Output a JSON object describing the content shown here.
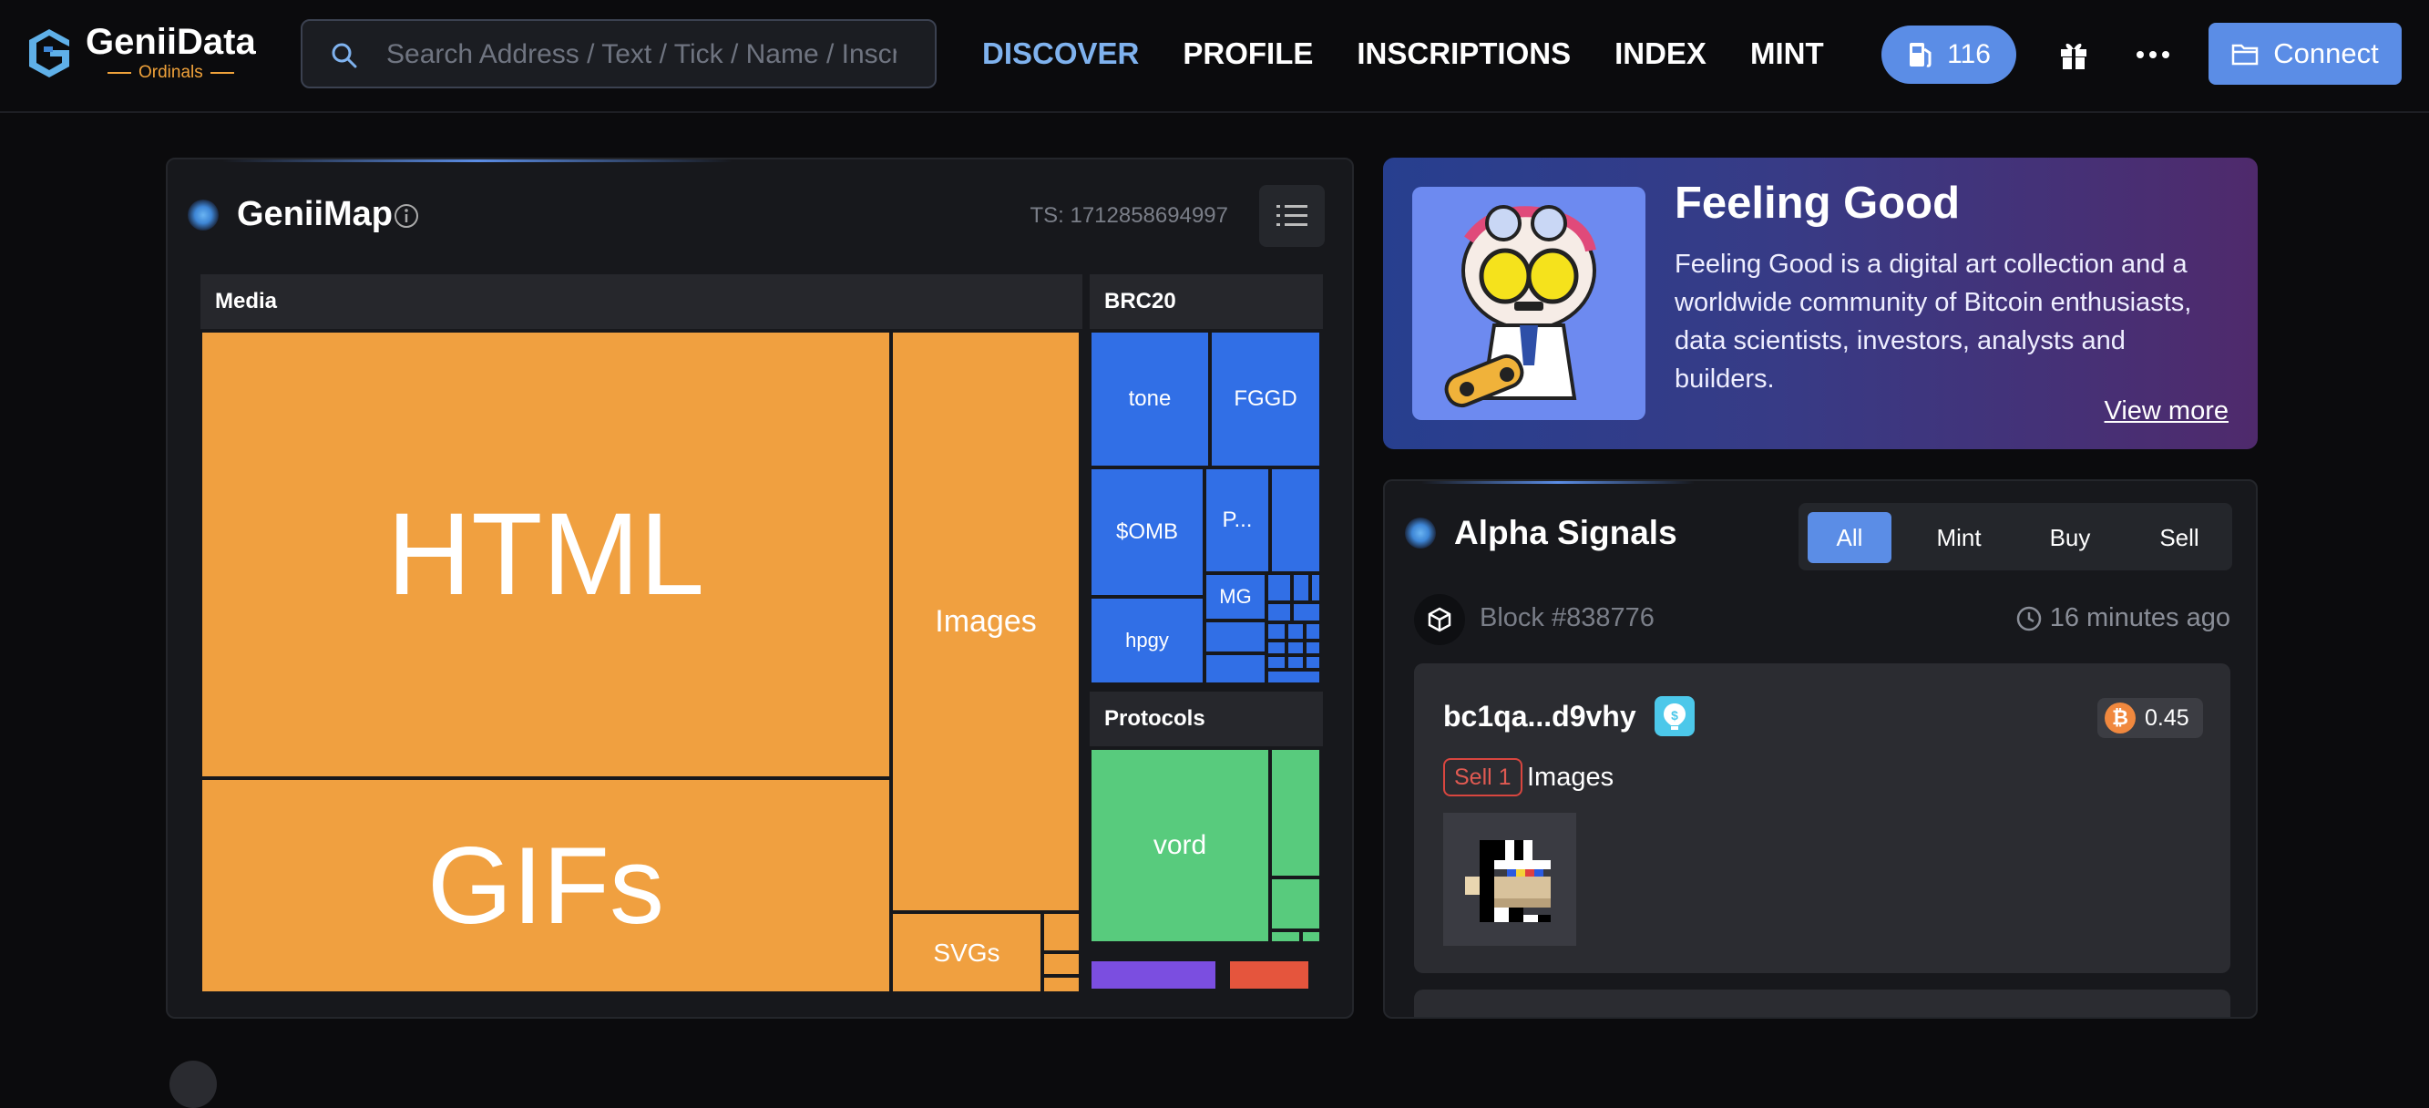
{
  "header": {
    "brand": "GeniiData",
    "brand_sub": "Ordinals",
    "search_placeholder": "Search Address / Text / Tick / Name / Inscription",
    "nav": [
      "DISCOVER",
      "PROFILE",
      "INSCRIPTIONS",
      "INDEX",
      "MINT"
    ],
    "active_nav": "DISCOVER",
    "gas_value": "116",
    "connect_label": "Connect",
    "icons": [
      "search-icon",
      "gas-pump-icon",
      "gift-icon",
      "more-dots-icon",
      "wallet-icon"
    ]
  },
  "geniimap": {
    "title": "GeniiMap",
    "ts": "TS: 1712858694997",
    "sections": {
      "media": "Media",
      "brc20": "BRC20",
      "protocols": "Protocols"
    },
    "media_cells": [
      "HTML",
      "GIFs",
      "Images",
      "SVGs"
    ],
    "brc20_cells": [
      "tone",
      "FGGD",
      "$OMB",
      "P...",
      "MG",
      "hpgy"
    ],
    "protocol_cells": [
      "vord"
    ],
    "colors": {
      "media": "#f0a040",
      "brc20": "#316fe6",
      "protocols": "#58cb7d",
      "purple": "#7b4ee0",
      "red": "#e5553d"
    }
  },
  "feature": {
    "title": "Feeling Good",
    "description": "Feeling Good is a digital art collection and a worldwide community of Bitcoin enthusiasts, data scientists, investors, analysts and builders.",
    "link": "View more"
  },
  "alpha": {
    "title": "Alpha Signals",
    "tabs": [
      "All",
      "Mint",
      "Buy",
      "Sell"
    ],
    "active_tab": "All",
    "block": "Block #838776",
    "time": "16 minutes ago",
    "address": "bc1qa...d9vhy",
    "price": "0.45",
    "action": "Sell 1",
    "type": "Images"
  }
}
